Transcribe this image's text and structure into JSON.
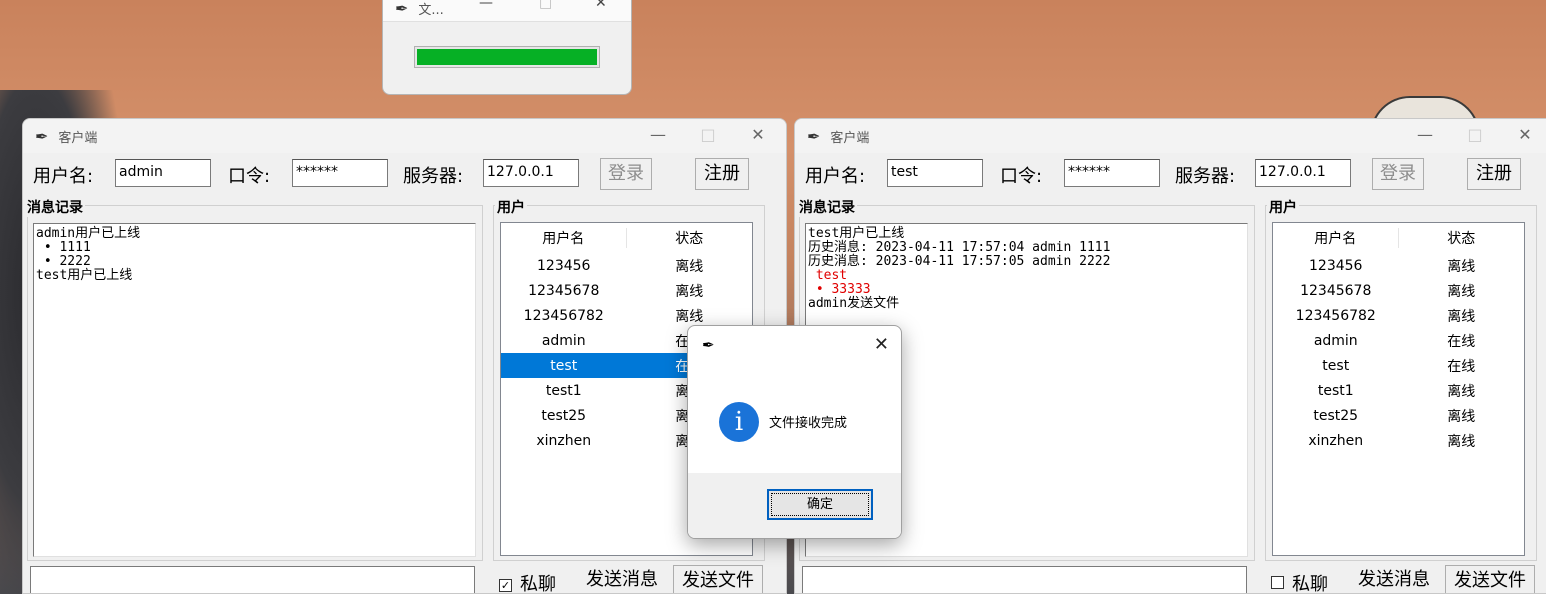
{
  "progress_window": {
    "title": "文...",
    "progress": 1.0
  },
  "left": {
    "title": "客户端",
    "username_label": "用户名:",
    "username": "admin",
    "password_label": "口令:",
    "password": "******",
    "server_label": "服务器:",
    "server": "127.0.0.1",
    "login": "登录",
    "register": "注册",
    "msg_group": "消息记录",
    "user_group": "用户",
    "messages": [
      {
        "text": "admin用户已上线",
        "red": false
      },
      {
        "text": " • 1111",
        "red": false
      },
      {
        "text": " • 2222",
        "red": false
      },
      {
        "text": "test用户已上线",
        "red": false
      }
    ],
    "col_name": "用户名",
    "col_status": "状态",
    "users": [
      {
        "name": "123456",
        "status": "离线"
      },
      {
        "name": "12345678",
        "status": "离线"
      },
      {
        "name": "123456782",
        "status": "离线"
      },
      {
        "name": "admin",
        "status": "在线"
      },
      {
        "name": "test",
        "status": "在线"
      },
      {
        "name": "test1",
        "status": "离线"
      },
      {
        "name": "test25",
        "status": "离线"
      },
      {
        "name": "xinzhen",
        "status": "离线"
      }
    ],
    "private": "私聊",
    "send_msg": "发送消息",
    "send_file": "发送文件"
  },
  "right": {
    "title": "客户端",
    "username_label": "用户名:",
    "username": "test",
    "password_label": "口令:",
    "password": "******",
    "server_label": "服务器:",
    "server": "127.0.0.1",
    "login": "登录",
    "register": "注册",
    "msg_group": "消息记录",
    "user_group": "用户",
    "messages": [
      {
        "text": "test用户已上线",
        "red": false
      },
      {
        "text": "历史消息: 2023-04-11 17:57:04 admin 1111",
        "red": false
      },
      {
        "text": "历史消息: 2023-04-11 17:57:05 admin 2222",
        "red": false
      },
      {
        "text": " test",
        "red": true
      },
      {
        "text": " • 33333",
        "red": true
      },
      {
        "text": "admin发送文件",
        "red": false
      }
    ],
    "col_name": "用户名",
    "col_status": "状态",
    "users": [
      {
        "name": "123456",
        "status": "离线"
      },
      {
        "name": "12345678",
        "status": "离线"
      },
      {
        "name": "123456782",
        "status": "离线"
      },
      {
        "name": "admin",
        "status": "在线"
      },
      {
        "name": "test",
        "status": "在线"
      },
      {
        "name": "test1",
        "status": "离线"
      },
      {
        "name": "test25",
        "status": "离线"
      },
      {
        "name": "xinzhen",
        "status": "离线"
      }
    ],
    "private": "私聊",
    "send_msg": "发送消息",
    "send_file": "发送文件"
  },
  "dialog": {
    "message": "文件接收完成",
    "ok": "确定"
  },
  "colors": {
    "progress": "#06b025",
    "selection": "#0078d7",
    "info": "#1a73d8",
    "red_text": "#e00000"
  }
}
